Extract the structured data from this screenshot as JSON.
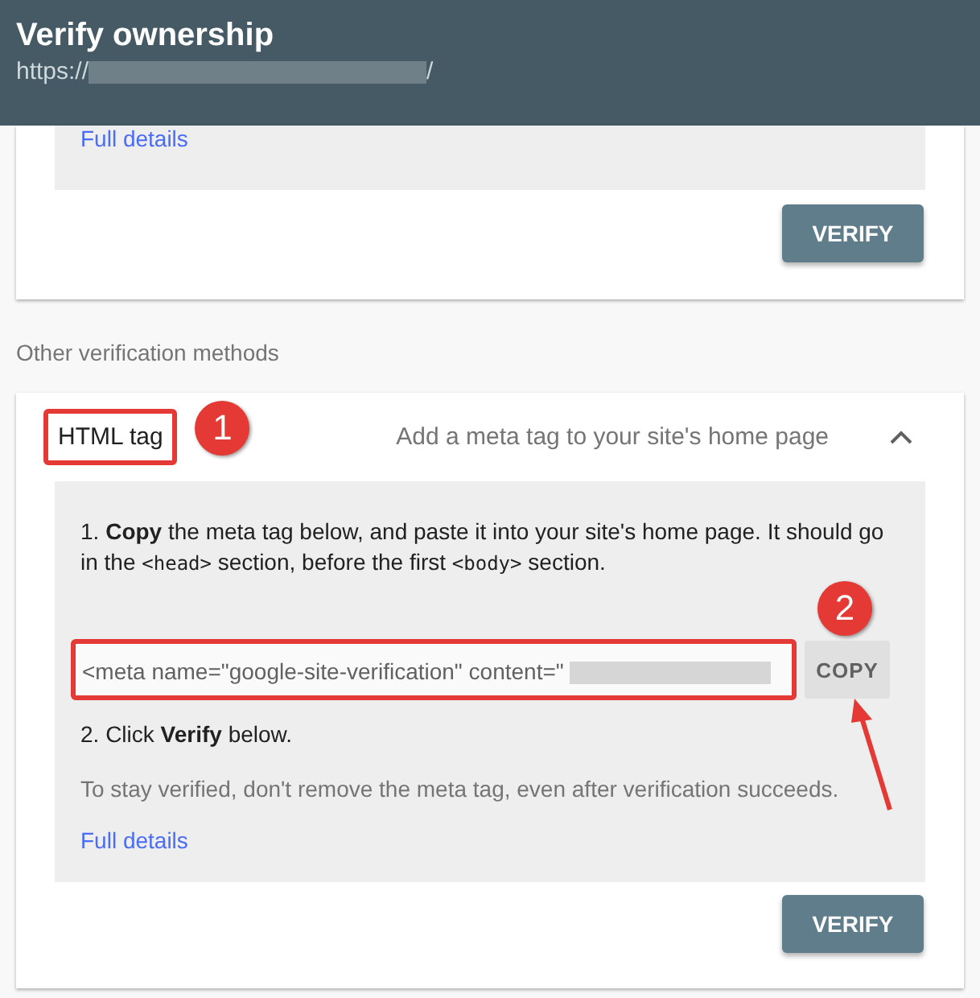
{
  "header": {
    "title": "Verify ownership",
    "url_prefix": "https://",
    "url_suffix": "/"
  },
  "top_method": {
    "link": "Full details",
    "button": "VERIFY"
  },
  "section_label": "Other verification methods",
  "method": {
    "name": "HTML tag",
    "description": "Add a meta tag to your site's home page",
    "expanded": true,
    "step_1": [
      {
        "kind": "text",
        "text": "1. **Copy** the meta tag below, and paste it into your site's home page. It should go in the "
      },
      {
        "kind": "code",
        "text": "<head>"
      },
      {
        "kind": "text",
        "text": " section, before the first "
      },
      {
        "kind": "code",
        "text": "<body>"
      },
      {
        "kind": "text",
        "text": " section."
      }
    ],
    "meta_tag": "<meta name=\"google-site-verification\" content=\"",
    "copy_button": "COPY",
    "step_2": "2. Click **Verify** below.",
    "note": "To stay verified, don't remove the meta tag, even after verification succeeds.",
    "link": "Full details",
    "button": "VERIFY"
  },
  "annotations": [
    {
      "label": "1"
    },
    {
      "label": "2"
    }
  ]
}
